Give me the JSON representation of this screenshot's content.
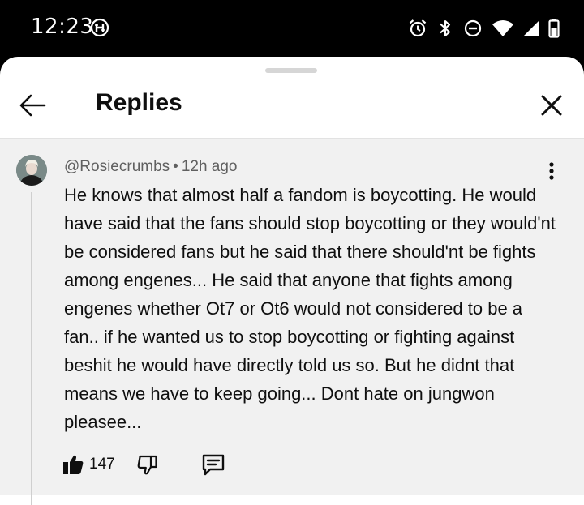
{
  "status_bar": {
    "time": "12:23",
    "icons": [
      "h-badge-icon",
      "alarm-icon",
      "bluetooth-icon",
      "do-not-disturb-icon",
      "wifi-icon",
      "signal-icon",
      "battery-icon"
    ]
  },
  "header": {
    "title": "Replies",
    "back_icon": "arrow-left-icon",
    "close_icon": "close-icon"
  },
  "comment": {
    "author": "@Rosiecrumbs",
    "separator": "•",
    "time_ago": "12h ago",
    "text": "He knows that almost half a fandom is boycotting. He would have said that the fans should stop boycotting or they would'nt be considered fans but he said that there should'nt be fights among engenes... He said that anyone that fights among engenes whether Ot7 or Ot6 would not considered to be a fan.. if he wanted us to stop boycotting or fighting against beshit he would have directly told us so. But he didnt that means we have to keep going... Dont hate on jungwon pleasee...",
    "like_count": "147",
    "actions": [
      "thumbs-up-icon",
      "thumbs-down-icon",
      "reply-icon"
    ]
  },
  "colors": {
    "status_bar_bg": "#000000",
    "sheet_bg": "#ffffff",
    "comment_bg": "#f1f1f1",
    "text_primary": "#0f0f0f",
    "text_secondary": "#606060"
  }
}
